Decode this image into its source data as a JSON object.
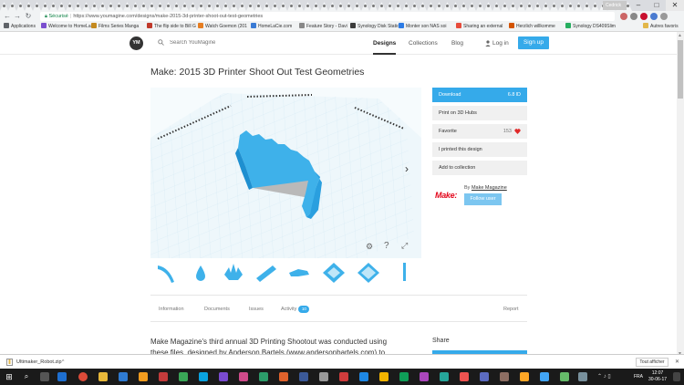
{
  "browser": {
    "secure_label": "Sécurisé",
    "url": "https://www.youmagine.com/designs/make-2015-3d-printer-shoot-out-test-geometries",
    "profile": "Cedrick",
    "bookmarks": [
      "Applications",
      "Welcome to HomeLa",
      "Films Series Manga",
      "The flip side to Bill G",
      "Watch Goemon (201",
      "HomeLaCie.com",
      "Feature Story - Davi",
      "Synology Disk Statio",
      "Monter son NAS soi",
      "Sharing an external",
      "Herzlich willkomme",
      "Synology DS409Slim",
      "Autres favoris"
    ]
  },
  "site": {
    "logo": "YM",
    "search_placeholder": "Search YouMagine",
    "nav": {
      "designs": "Designs",
      "collections": "Collections",
      "blog": "Blog",
      "login": "Log in",
      "signup": "Sign up"
    }
  },
  "design": {
    "title": "Make: 2015 3D Printer Shoot Out Test Geometries",
    "download_label": "Download",
    "download_size": "6.8 ID",
    "print_label": "Print on 3D Hubs",
    "favorite_label": "Favorite",
    "favorite_count": "153",
    "printed_label": "I printed this design",
    "collection_label": "Add to collection",
    "make_logo": "Make:",
    "by_label": "By",
    "author": "Make Magazine",
    "follow_label": "Follow user",
    "share_label": "Share"
  },
  "tabs": {
    "information": "Information",
    "documents": "Documents",
    "issues": "Issues",
    "activity": "Activity",
    "activity_count": "10",
    "report": "Report"
  },
  "description": {
    "line1": "Make Magazine's third annual 3D Printing Shootout was conducted using",
    "line2": "these files, designed by Anderson Bartels (www.andersonbartels.com) to"
  },
  "download_shelf": {
    "file": "Ultimaker_Robot.zip",
    "show_all": "Tout afficher"
  },
  "taskbar": {
    "lang": "FRA",
    "time": "12:07",
    "date": "30-06-17"
  },
  "colors": {
    "accent": "#35aaea",
    "model": "#3eb1ea",
    "make_red": "#e3061b"
  }
}
